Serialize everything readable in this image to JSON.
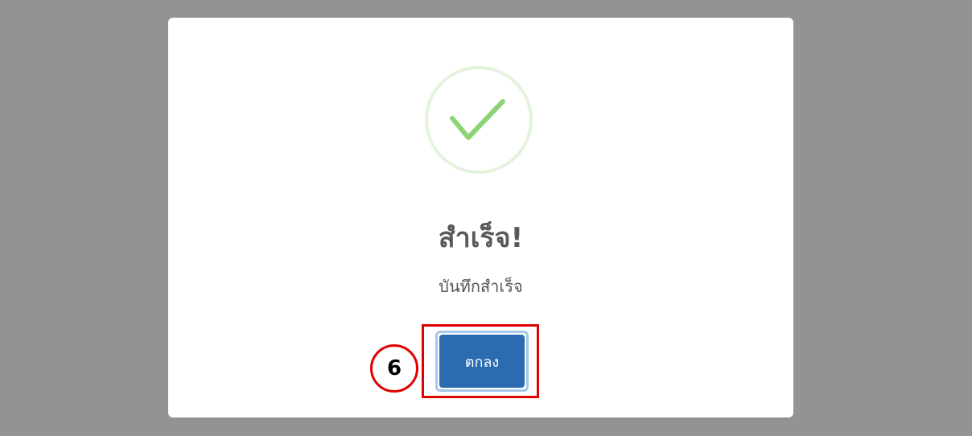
{
  "dialog": {
    "title": "สำเร็จ!",
    "message": "บันทึกสำเร็จ",
    "confirm_label": "ตกลง",
    "icon": "check-icon"
  },
  "annotation": {
    "step_number": "6"
  },
  "colors": {
    "backdrop": "#939393",
    "check": "#8cd476",
    "check_ring": "#e3f3dc",
    "button": "#2b6cb0",
    "highlight": "#e10000"
  }
}
